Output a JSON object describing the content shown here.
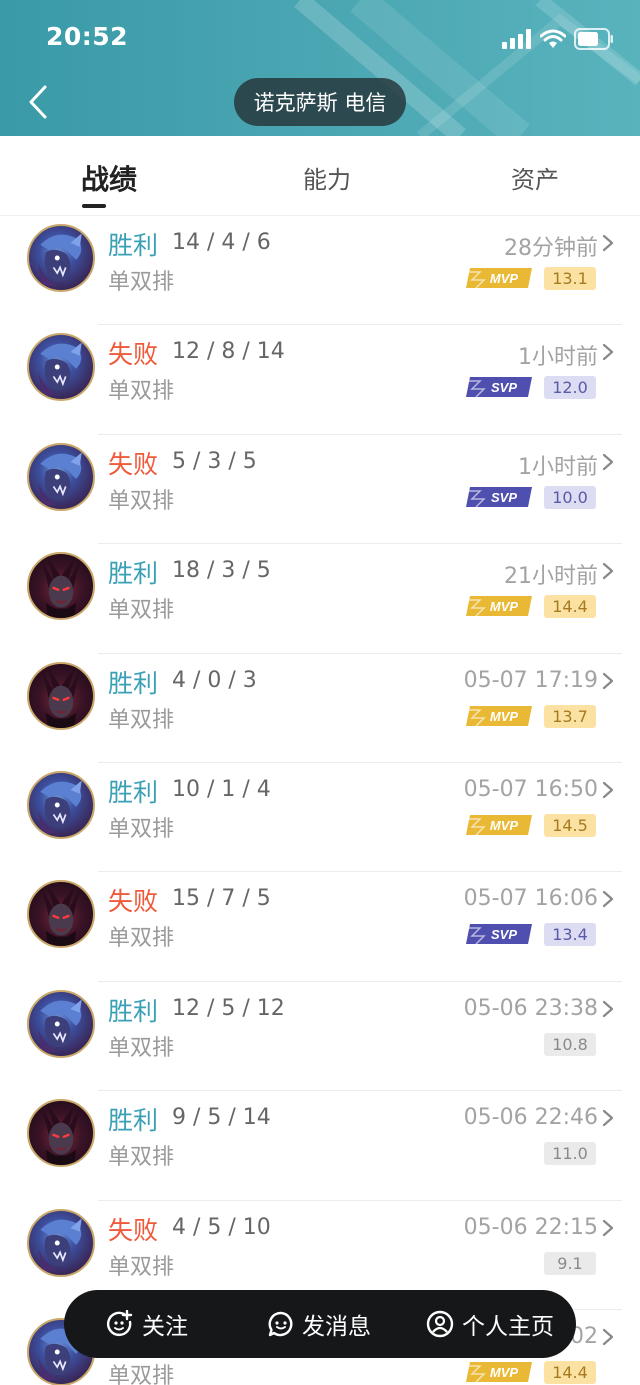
{
  "status_bar": {
    "time": "20:52"
  },
  "header": {
    "server_label": "诺克萨斯 电信"
  },
  "tabs": [
    {
      "label": "战绩",
      "active": true
    },
    {
      "label": "能力",
      "active": false
    },
    {
      "label": "资产",
      "active": false
    }
  ],
  "colors": {
    "win": "#3aa0b5",
    "lose": "#ee5a3a",
    "mvp": "#e9b935",
    "svp": "#4e4fae",
    "header": "#4aa6b2"
  },
  "matches": [
    {
      "result": "胜利",
      "outcome": "win",
      "kda": "14 / 4 / 6",
      "mode": "单双排",
      "time": "28分钟前",
      "badge": "MVP",
      "score": "13.1",
      "champion": "blue-creature"
    },
    {
      "result": "失败",
      "outcome": "lose",
      "kda": "12 / 8 / 14",
      "mode": "单双排",
      "time": "1小时前",
      "badge": "SVP",
      "score": "12.0",
      "champion": "blue-creature"
    },
    {
      "result": "失败",
      "outcome": "lose",
      "kda": "5 / 3 / 5",
      "mode": "单双排",
      "time": "1小时前",
      "badge": "SVP",
      "score": "10.0",
      "champion": "blue-creature"
    },
    {
      "result": "胜利",
      "outcome": "win",
      "kda": "18 / 3 / 5",
      "mode": "单双排",
      "time": "21小时前",
      "badge": "MVP",
      "score": "14.4",
      "champion": "dark-queen"
    },
    {
      "result": "胜利",
      "outcome": "win",
      "kda": "4 / 0 / 3",
      "mode": "单双排",
      "time": "05-07 17:19",
      "badge": "MVP",
      "score": "13.7",
      "champion": "dark-queen"
    },
    {
      "result": "胜利",
      "outcome": "win",
      "kda": "10 / 1 / 4",
      "mode": "单双排",
      "time": "05-07 16:50",
      "badge": "MVP",
      "score": "14.5",
      "champion": "blue-creature"
    },
    {
      "result": "失败",
      "outcome": "lose",
      "kda": "15 / 7 / 5",
      "mode": "单双排",
      "time": "05-07 16:06",
      "badge": "SVP",
      "score": "13.4",
      "champion": "dark-queen"
    },
    {
      "result": "胜利",
      "outcome": "win",
      "kda": "12 / 5 / 12",
      "mode": "单双排",
      "time": "05-06 23:38",
      "badge": "",
      "score": "10.8",
      "champion": "blue-creature"
    },
    {
      "result": "胜利",
      "outcome": "win",
      "kda": "9 / 5 / 14",
      "mode": "单双排",
      "time": "05-06 22:46",
      "badge": "",
      "score": "11.0",
      "champion": "dark-queen"
    },
    {
      "result": "失败",
      "outcome": "lose",
      "kda": "4 / 5 / 10",
      "mode": "单双排",
      "time": "05-06 22:15",
      "badge": "",
      "score": "9.1",
      "champion": "blue-creature"
    },
    {
      "result": "",
      "outcome": "win",
      "kda": "",
      "mode": "单双排",
      "time": "02",
      "badge": "MVP",
      "score": "14.4",
      "champion": "blue-creature"
    }
  ],
  "action_bar": {
    "follow": "关注",
    "message": "发消息",
    "profile": "个人主页"
  }
}
